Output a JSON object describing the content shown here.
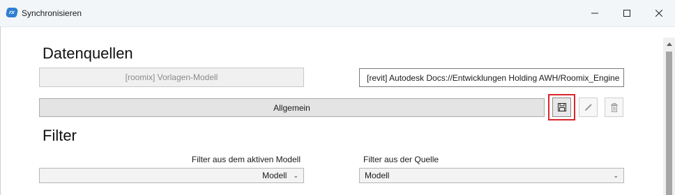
{
  "window": {
    "title": "Synchronisieren",
    "app_icon_text": "rx"
  },
  "sources": {
    "heading": "Datenquellen",
    "left_source": "[roomix] Vorlagen-Modell",
    "right_source": "[revit] Autodesk Docs://Entwicklungen Holding AWH/Roomix_Engine",
    "profile_label": "Allgemein"
  },
  "filter": {
    "heading": "Filter",
    "left_label": "Filter aus dem aktiven Modell",
    "left_value": "Modell",
    "right_label": "Filter aus der Quelle",
    "right_value": "Modell"
  },
  "icons": {
    "save": "save-icon",
    "edit": "pencil-icon",
    "delete": "trash-icon"
  },
  "colors": {
    "highlight": "#d9252a",
    "app_icon": "#2f7fd0"
  }
}
